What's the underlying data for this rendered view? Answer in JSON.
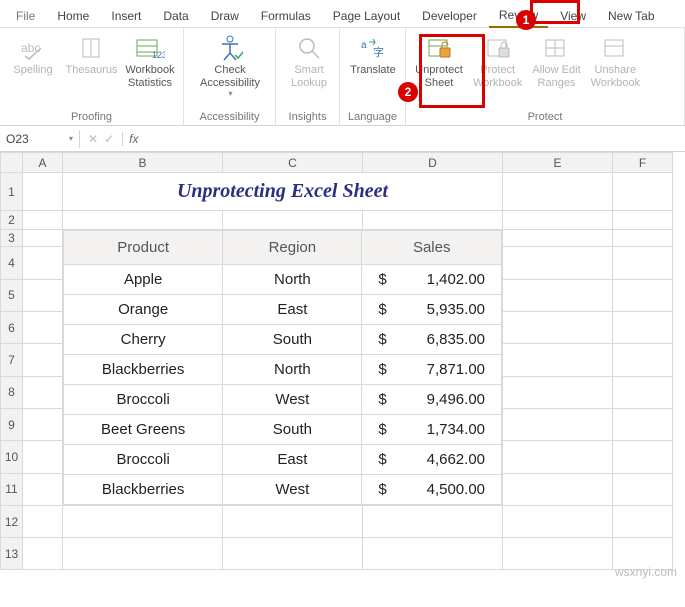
{
  "tabs": {
    "file": "File",
    "home": "Home",
    "insert": "Insert",
    "data": "Data",
    "draw": "Draw",
    "formulas": "Formulas",
    "pagelayout": "Page Layout",
    "developer": "Developer",
    "review": "Review",
    "view": "View",
    "newtab": "New Tab"
  },
  "ribbon_groups": {
    "proofing": {
      "label": "Proofing",
      "spelling": "Spelling",
      "thesaurus": "Thesaurus",
      "workbook_stats_l1": "Workbook",
      "workbook_stats_l2": "Statistics"
    },
    "accessibility": {
      "label": "Accessibility",
      "check_l1": "Check",
      "check_l2": "Accessibility"
    },
    "insights": {
      "label": "Insights",
      "smart_l1": "Smart",
      "smart_l2": "Lookup"
    },
    "language": {
      "label": "Language",
      "translate": "Translate"
    },
    "protect": {
      "label": "Protect",
      "unprotect_l1": "Unprotect",
      "unprotect_l2": "Sheet",
      "protectwb_l1": "Protect",
      "protectwb_l2": "Workbook",
      "allowedit_l1": "Allow Edit",
      "allowedit_l2": "Ranges",
      "unshare_l1": "Unshare",
      "unshare_l2": "Workbook"
    }
  },
  "badges": {
    "one": "1",
    "two": "2"
  },
  "formula_bar": {
    "namebox": "O23",
    "fx": "fx"
  },
  "columns": [
    "A",
    "B",
    "C",
    "D",
    "E",
    "F"
  ],
  "rows": [
    "1",
    "2",
    "3",
    "4",
    "5",
    "6",
    "7",
    "8",
    "9",
    "10",
    "11",
    "12",
    "13"
  ],
  "sheet_title": "Unprotecting Excel Sheet",
  "data_table": {
    "headers": {
      "product": "Product",
      "region": "Region",
      "sales": "Sales"
    },
    "currency": "$",
    "rows": [
      {
        "product": "Apple",
        "region": "North",
        "sales": "1,402.00"
      },
      {
        "product": "Orange",
        "region": "East",
        "sales": "5,935.00"
      },
      {
        "product": "Cherry",
        "region": "South",
        "sales": "6,835.00"
      },
      {
        "product": "Blackberries",
        "region": "North",
        "sales": "7,871.00"
      },
      {
        "product": "Broccoli",
        "region": "West",
        "sales": "9,496.00"
      },
      {
        "product": "Beet Greens",
        "region": "South",
        "sales": "1,734.00"
      },
      {
        "product": "Broccoli",
        "region": "East",
        "sales": "4,662.00"
      },
      {
        "product": "Blackberries",
        "region": "West",
        "sales": "4,500.00"
      }
    ]
  },
  "watermark": "wsxnyi.com"
}
